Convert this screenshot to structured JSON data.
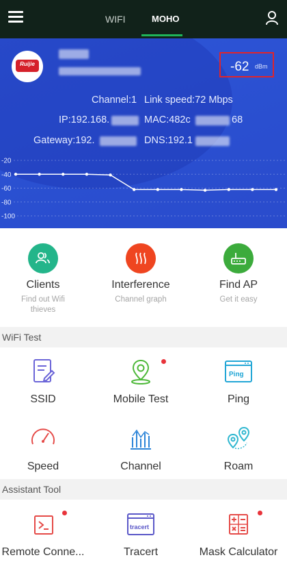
{
  "topbar": {
    "tabs": [
      {
        "label": "WIFI",
        "active": false
      },
      {
        "label": "MOHO",
        "active": true
      }
    ],
    "accent": "#1fb55a"
  },
  "wifi": {
    "brand": "Ruijie",
    "signal_value": "-62",
    "signal_unit": "dBm",
    "channel": "Channel:1",
    "link_speed": "Link speed:72 Mbps",
    "ip": "IP:192.168.",
    "mac": "MAC:482c",
    "mac_tail": "68",
    "gateway": "Gateway:192.",
    "dns": "DNS:192.1"
  },
  "chart_data": {
    "type": "line",
    "y_ticks": [
      "-20",
      "-40",
      "-60",
      "-80",
      "-100"
    ],
    "ylim": [
      -100,
      -20
    ],
    "series": [
      {
        "values": [
          -40,
          -40,
          -40,
          -40,
          -41,
          -62,
          -62,
          -62,
          -63,
          -62,
          -62,
          -62
        ]
      }
    ]
  },
  "quick_actions": [
    {
      "title": "Clients",
      "subtitle": "Find out Wifi thieves",
      "icon": "clients-icon",
      "color": "#23b58a"
    },
    {
      "title": "Interference",
      "subtitle": "Channel graph",
      "icon": "interference-icon",
      "color": "#ef4520"
    },
    {
      "title": "Find AP",
      "subtitle": "Get it easy",
      "icon": "router-icon",
      "color": "#3cab3c"
    }
  ],
  "sections": {
    "wifi_test": "WiFi Test",
    "assistant_tool": "Assistant Tool"
  },
  "wifi_test": [
    {
      "label": "SSID",
      "icon": "document-edit-icon",
      "color": "#6b65d8",
      "dot": false
    },
    {
      "label": "Mobile Test",
      "icon": "location-pin-icon",
      "color": "#4cb838",
      "dot": true
    },
    {
      "label": "Ping",
      "icon": "ping-icon",
      "color": "#22a6d6",
      "dot": false,
      "text": "Ping"
    },
    {
      "label": "Speed",
      "icon": "speedometer-icon",
      "color": "#e54a47",
      "dot": false
    },
    {
      "label": "Channel",
      "icon": "channel-bars-icon",
      "color": "#2b84d8",
      "dot": false
    },
    {
      "label": "Roam",
      "icon": "roam-pins-icon",
      "color": "#2fb7d0",
      "dot": false
    }
  ],
  "assistant_tools": [
    {
      "label": "Remote Conne...",
      "icon": "terminal-icon",
      "color": "#e54a47",
      "dot": true
    },
    {
      "label": "Tracert",
      "icon": "tracert-icon",
      "color": "#5a57c8",
      "dot": false,
      "text": "tracert"
    },
    {
      "label": "Mask Calculator",
      "icon": "calculator-icon",
      "color": "#e54a47",
      "dot": true
    }
  ]
}
